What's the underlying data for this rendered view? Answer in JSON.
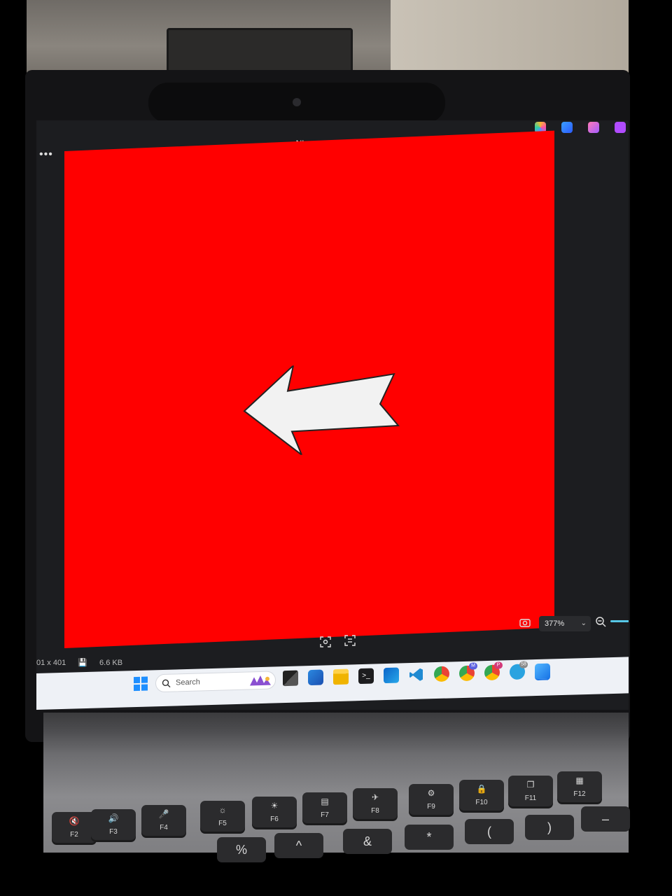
{
  "window": {
    "title": "NL.png"
  },
  "viewer": {
    "more_label": "•••",
    "zoom_level": "377%",
    "zoom_chevron": "⌄"
  },
  "status": {
    "dimensions": "01 x 401",
    "file_size": "6.6 KB"
  },
  "taskbar": {
    "search_placeholder": "Search",
    "badges": {
      "chrome_m": "M",
      "chrome_p": "P",
      "telegram": "58"
    }
  },
  "keyboard": {
    "fkeys": [
      "F2",
      "F3",
      "F4",
      "F5",
      "F6",
      "F7",
      "F8",
      "F9",
      "F10",
      "F11",
      "F12"
    ],
    "symbol_keys": [
      "%",
      "^",
      "&",
      "*",
      "(",
      ")",
      "–"
    ]
  },
  "colors": {
    "image_red": "#ff0000",
    "screen_bg": "#1c1d20",
    "taskbar_bg": "#eef1f6",
    "accent": "#57c7e6"
  }
}
